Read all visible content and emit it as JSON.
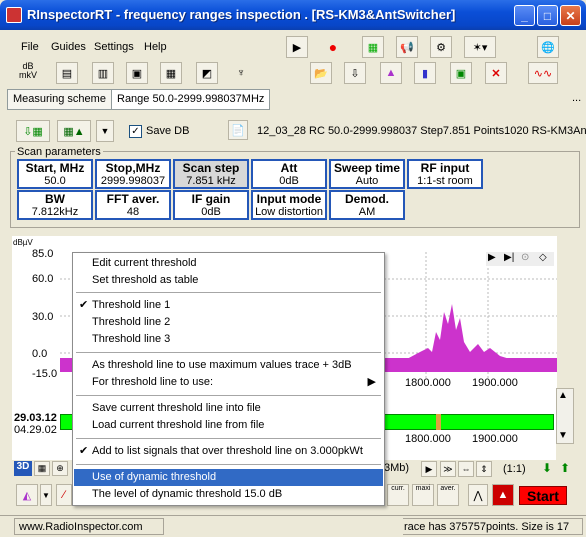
{
  "window": {
    "title": "RInspectorRT - frequency ranges inspection . [RS-KM3&AntSwitcher]"
  },
  "menu": [
    "File",
    "Guides",
    "Settings",
    "Help"
  ],
  "toolbar": {
    "db_label": "dB\nmkV"
  },
  "tabs": {
    "measuring_scheme": "Measuring scheme",
    "range": "Range 50.0-2999.998037MHz",
    "more": "..."
  },
  "row3": {
    "save_db_label": "Save DB",
    "save_db_checked": true,
    "info": "12_03_28 RC 50.0-2999.998037 Step7.851 Points1020 RS-KM3An"
  },
  "scan": {
    "legend": "Scan parameters",
    "params": [
      {
        "label": "Start, MHz",
        "value": "50.0"
      },
      {
        "label": "Stop,MHz",
        "value": "2999.998037"
      },
      {
        "label": "Scan step",
        "value": "7.851 kHz"
      },
      {
        "label": "Att",
        "value": "0dB"
      },
      {
        "label": "Sweep time",
        "value": "Auto"
      },
      {
        "label": "RF input",
        "value": "1:1-st room"
      },
      {
        "label": "BW",
        "value": "7.812kHz"
      },
      {
        "label": "FFT aver.",
        "value": "48"
      },
      {
        "label": "IF gain",
        "value": "0dB"
      },
      {
        "label": "Input mode",
        "value": "Low distortion"
      },
      {
        "label": "Demod.",
        "value": "AM"
      }
    ]
  },
  "chart": {
    "y_unit": "dBµV",
    "y_ticks": [
      "85.0",
      "60.0",
      "30.0",
      "0.0",
      "-15.0"
    ],
    "x_ticks": [
      "1800.000",
      "1900.000"
    ],
    "trace_color": "#cc33cc"
  },
  "waterfall": {
    "date_top": "29.03.12",
    "date_bottom": "04.29.02",
    "x_ticks": [
      "1800.000",
      "1900.000"
    ],
    "label_partial": "3Mb)",
    "zoom": "(1:1)"
  },
  "context_menu": {
    "items": [
      {
        "label": "Edit current threshold",
        "checked": false
      },
      {
        "label": "Set threshold as table",
        "checked": false
      },
      {
        "label": "Threshold line 1",
        "checked": true
      },
      {
        "label": "Threshold line 2",
        "checked": false
      },
      {
        "label": "Threshold line 3",
        "checked": false
      },
      {
        "label": "As threshold line to use maximum values trace + 3dB",
        "checked": false
      },
      {
        "label": "For threshold line to use:",
        "checked": false,
        "submenu": true
      },
      {
        "label": "Save current threshold line into file",
        "checked": false
      },
      {
        "label": "Load current threshold line from file",
        "checked": false
      },
      {
        "label": "Add to list signals that over threshold line on 3.000pkWt",
        "checked": true
      },
      {
        "label": "Use of dynamic threshold",
        "checked": false,
        "selected": true
      },
      {
        "label": "The level of dynamic threshold 15.0 dB",
        "checked": false
      }
    ]
  },
  "bottom": {
    "curr": "curr.",
    "maxi": "maxi",
    "aver": "aver.",
    "start": "Start",
    "threed": "3D"
  },
  "status": {
    "url": "www.RadioInspector.com",
    "trace_info": "race has 375757points. Size is 17"
  },
  "colors": {
    "accent": "#2457b8",
    "highlight": "#316ac5",
    "start_button": "#ff0000",
    "waterfall": "#00ff00"
  }
}
